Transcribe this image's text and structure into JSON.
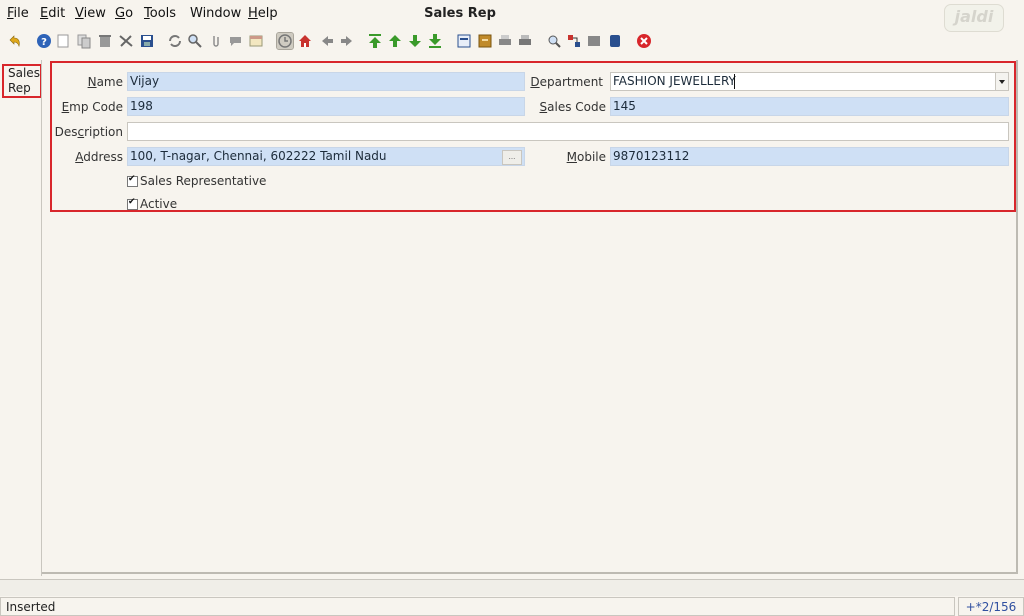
{
  "menu": {
    "file": {
      "u": "F",
      "rest": "ile"
    },
    "edit": {
      "u": "E",
      "rest": "dit"
    },
    "view": {
      "u": "V",
      "rest": "iew"
    },
    "go": {
      "u": "G",
      "rest": "o"
    },
    "tools": {
      "u": "T",
      "rest": "ools"
    },
    "window": "Window",
    "help": {
      "u": "H",
      "rest": "elp"
    }
  },
  "window_title": "Sales Rep",
  "brand": "jaldi",
  "toolbar_icons": [
    "undo-icon",
    "help-icon",
    "new-icon",
    "copy-icon",
    "delete-icon",
    "delete-multiple-icon",
    "save-icon",
    "refresh-icon",
    "find-icon",
    "attachment-icon",
    "chat-icon",
    "history-icon",
    "grid-toggle-icon",
    "home-icon",
    "back-icon",
    "forward-icon",
    "first-record-icon",
    "previous-record-icon",
    "next-record-icon",
    "last-record-icon",
    "report-icon",
    "archive-icon",
    "print-preview-icon",
    "print-icon",
    "zoom-across-icon",
    "request-icon",
    "product-info-icon",
    "workflow-icon",
    "close-window-icon"
  ],
  "side_tab": {
    "line1": "Sales",
    "line2": "Rep"
  },
  "form": {
    "name": {
      "u": "N",
      "rest": "ame",
      "value": "Vijay"
    },
    "department": {
      "u": "D",
      "rest": "epartment",
      "value": "FASHION JEWELLERY"
    },
    "emp_code": {
      "u": "E",
      "rest": "mp Code",
      "value": "198"
    },
    "sales_code": {
      "u": "S",
      "rest": "ales Code",
      "value": "145"
    },
    "description": {
      "pre": "Des",
      "u": "c",
      "rest": "ription",
      "value": ""
    },
    "address": {
      "u": "A",
      "rest": "ddress",
      "value": "100, T-nagar, Chennai,  602222 Tamil Nadu",
      "button": "..."
    },
    "mobile": {
      "u": "M",
      "rest": "obile",
      "value": "9870123112"
    },
    "sales_rep_checkbox": {
      "label": "Sales Representative",
      "checked": true
    },
    "active_checkbox": {
      "label": "Active",
      "checked": true
    }
  },
  "status": {
    "message": "Inserted",
    "record_count": "+*2/156"
  },
  "colors": {
    "field_bg": "#cfe0f5",
    "highlight_border": "#d8262b",
    "background": "#f7f4ee"
  }
}
